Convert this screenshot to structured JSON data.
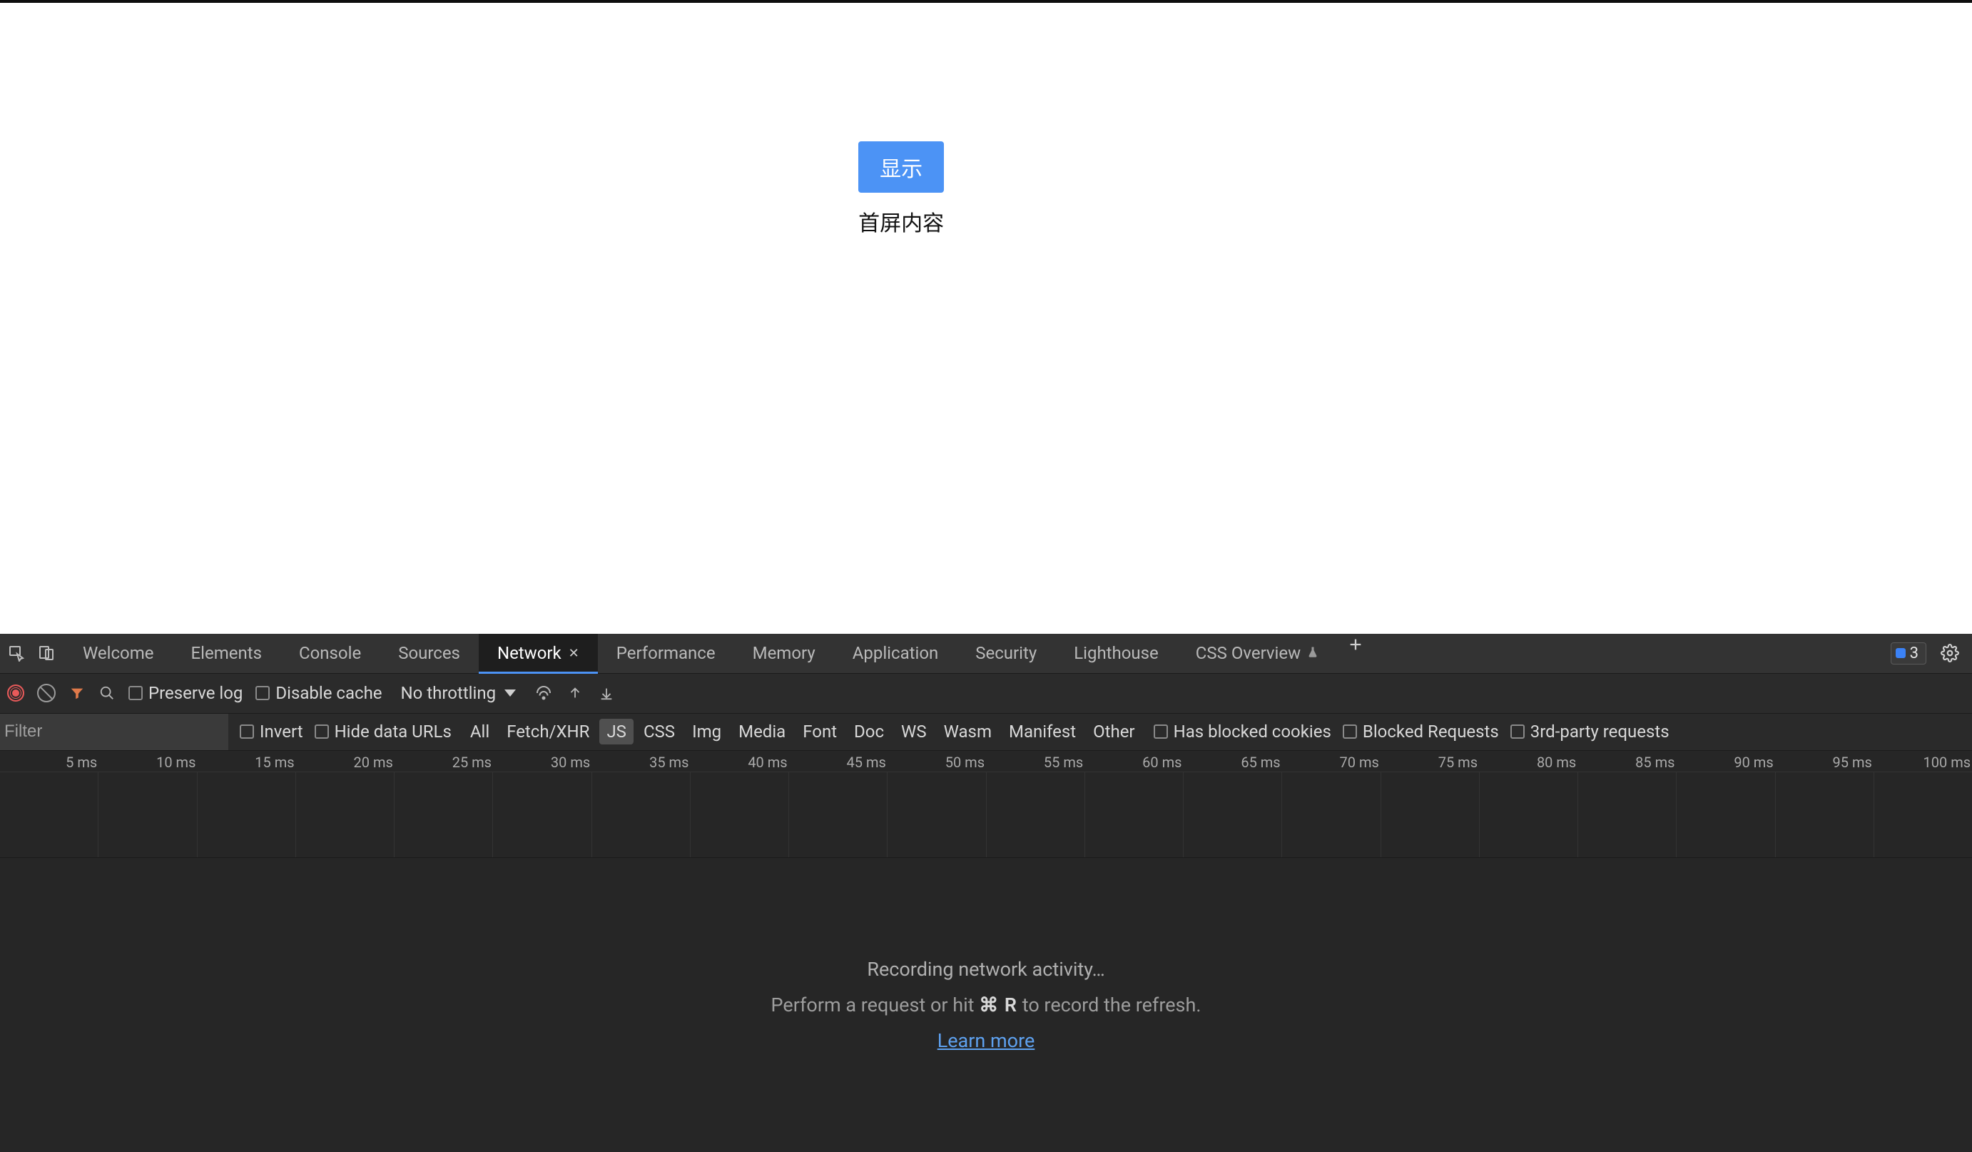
{
  "page": {
    "button_label": "显示",
    "text": "首屏内容"
  },
  "devtools": {
    "tabs": [
      "Welcome",
      "Elements",
      "Console",
      "Sources",
      "Network",
      "Performance",
      "Memory",
      "Application",
      "Security",
      "Lighthouse",
      "CSS Overview"
    ],
    "active_tab": "Network",
    "experimental_tab": "CSS Overview",
    "messages_count": "3"
  },
  "toolbar": {
    "preserve_log": "Preserve log",
    "disable_cache": "Disable cache",
    "throttling": "No throttling"
  },
  "filterbar": {
    "placeholder": "Filter",
    "invert": "Invert",
    "hide_data_urls": "Hide data URLs",
    "types": [
      "All",
      "Fetch/XHR",
      "JS",
      "CSS",
      "Img",
      "Media",
      "Font",
      "Doc",
      "WS",
      "Wasm",
      "Manifest",
      "Other"
    ],
    "selected_type": "JS",
    "has_blocked_cookies": "Has blocked cookies",
    "blocked_requests": "Blocked Requests",
    "third_party": "3rd-party requests"
  },
  "timeline": {
    "ticks": [
      "5 ms",
      "10 ms",
      "15 ms",
      "20 ms",
      "25 ms",
      "30 ms",
      "35 ms",
      "40 ms",
      "45 ms",
      "50 ms",
      "55 ms",
      "60 ms",
      "65 ms",
      "70 ms",
      "75 ms",
      "80 ms",
      "85 ms",
      "90 ms",
      "95 ms",
      "100 ms"
    ]
  },
  "empty": {
    "line1": "Recording network activity…",
    "line2_pre": "Perform a request or hit ",
    "line2_kbd": "⌘ R",
    "line2_post": " to record the refresh.",
    "learn_more": "Learn more"
  }
}
